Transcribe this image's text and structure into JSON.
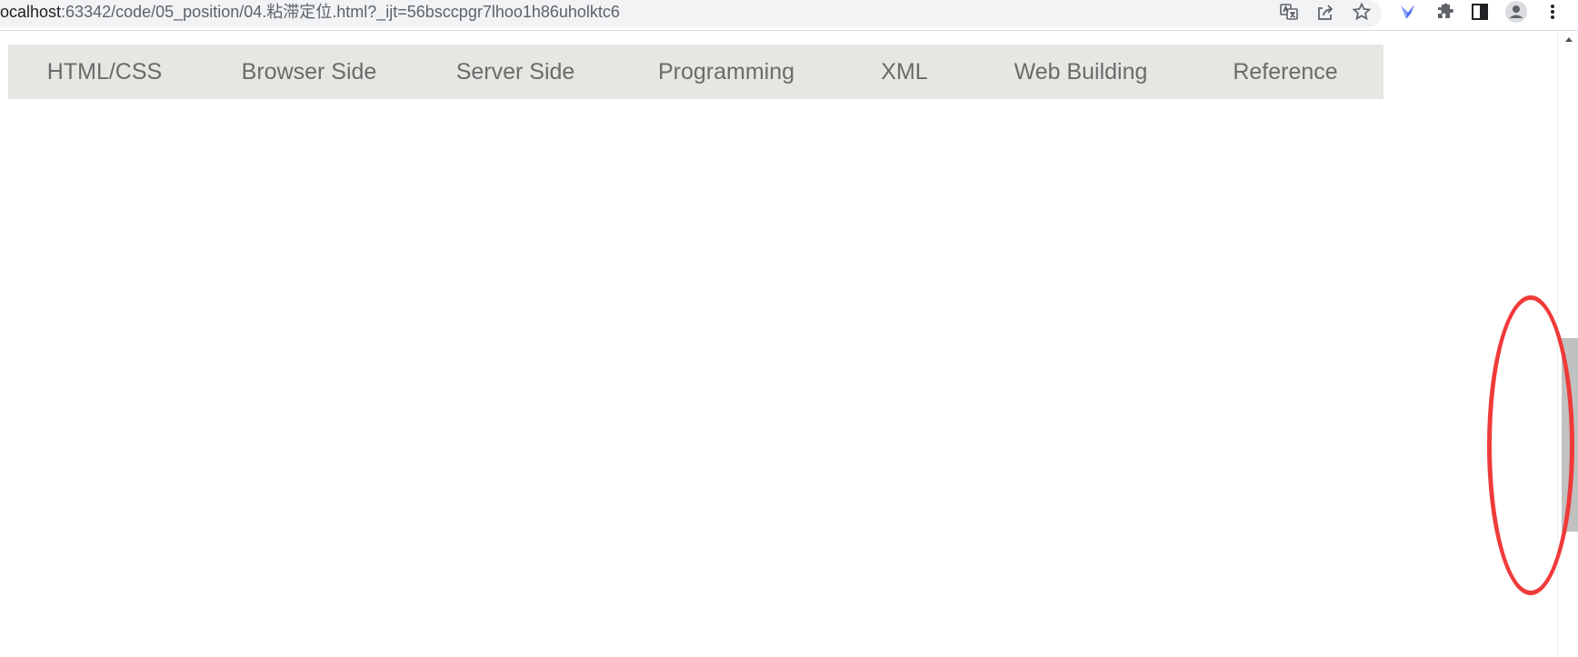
{
  "browser": {
    "url_host": "ocalhost",
    "url_rest": ":63342/code/05_position/04.粘滞定位.html?_ijt=56bsccpgr7lhoo1h86uholktc6",
    "icons": [
      "translate-icon",
      "share-icon",
      "bookmark-star-icon",
      "extension-bird-icon",
      "extensions-puzzle-icon",
      "side-panel-icon",
      "profile-avatar-icon",
      "menu-kebab-icon"
    ]
  },
  "nav": {
    "background": "#e7e6e2",
    "text_color": "#6b6b6b",
    "items": [
      {
        "label": "HTML/CSS"
      },
      {
        "label": "Browser Side"
      },
      {
        "label": "Server Side"
      },
      {
        "label": "Programming"
      },
      {
        "label": "XML"
      },
      {
        "label": "Web Building"
      },
      {
        "label": "Reference"
      }
    ]
  },
  "annotation": {
    "shape": "ellipse",
    "color": "#f03a3a",
    "target": "scrollbar-thumb"
  }
}
